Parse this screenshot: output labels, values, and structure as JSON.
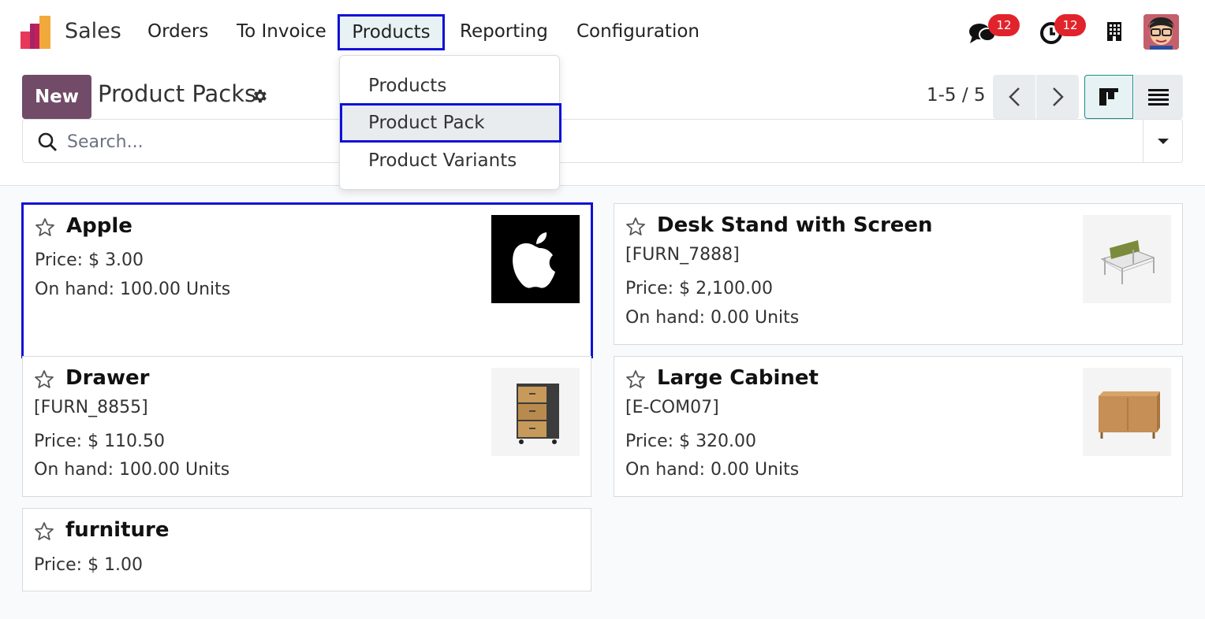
{
  "navbar": {
    "app_name": "Sales",
    "menu": [
      "Orders",
      "To Invoice",
      "Products",
      "Reporting",
      "Configuration"
    ],
    "messages_badge": "12",
    "activities_badge": "12"
  },
  "products_menu": {
    "items": [
      "Products",
      "Product Pack",
      "Product Variants"
    ],
    "highlighted": "Product Pack"
  },
  "control_panel": {
    "new_button": "New",
    "title": "Product Packs",
    "pager": "1-5 / 5",
    "search_placeholder": "Search...",
    "active_view": "kanban"
  },
  "cards": [
    {
      "name": "Apple",
      "ref": "",
      "price": "Price: $ 3.00",
      "onhand": "On hand: 100.00 Units",
      "image": "apple-logo"
    },
    {
      "name": "Desk Stand with Screen",
      "ref": "[FURN_7888]",
      "price": "Price: $ 2,100.00",
      "onhand": "On hand: 0.00 Units",
      "image": "desk-stand"
    },
    {
      "name": "Drawer",
      "ref": "[FURN_8855]",
      "price": "Price: $ 110.50",
      "onhand": "On hand: 100.00 Units",
      "image": "drawer"
    },
    {
      "name": "Large Cabinet",
      "ref": "[E-COM07]",
      "price": "Price: $ 320.00",
      "onhand": "On hand: 0.00 Units",
      "image": "cabinet"
    },
    {
      "name": "furniture",
      "ref": "",
      "price": "Price: $ 1.00",
      "onhand": "",
      "image": ""
    }
  ],
  "colors": {
    "brand": "#714b67",
    "highlight_border": "#1010d8",
    "badge": "#e1242c",
    "active_view": "#1f8b8a"
  }
}
